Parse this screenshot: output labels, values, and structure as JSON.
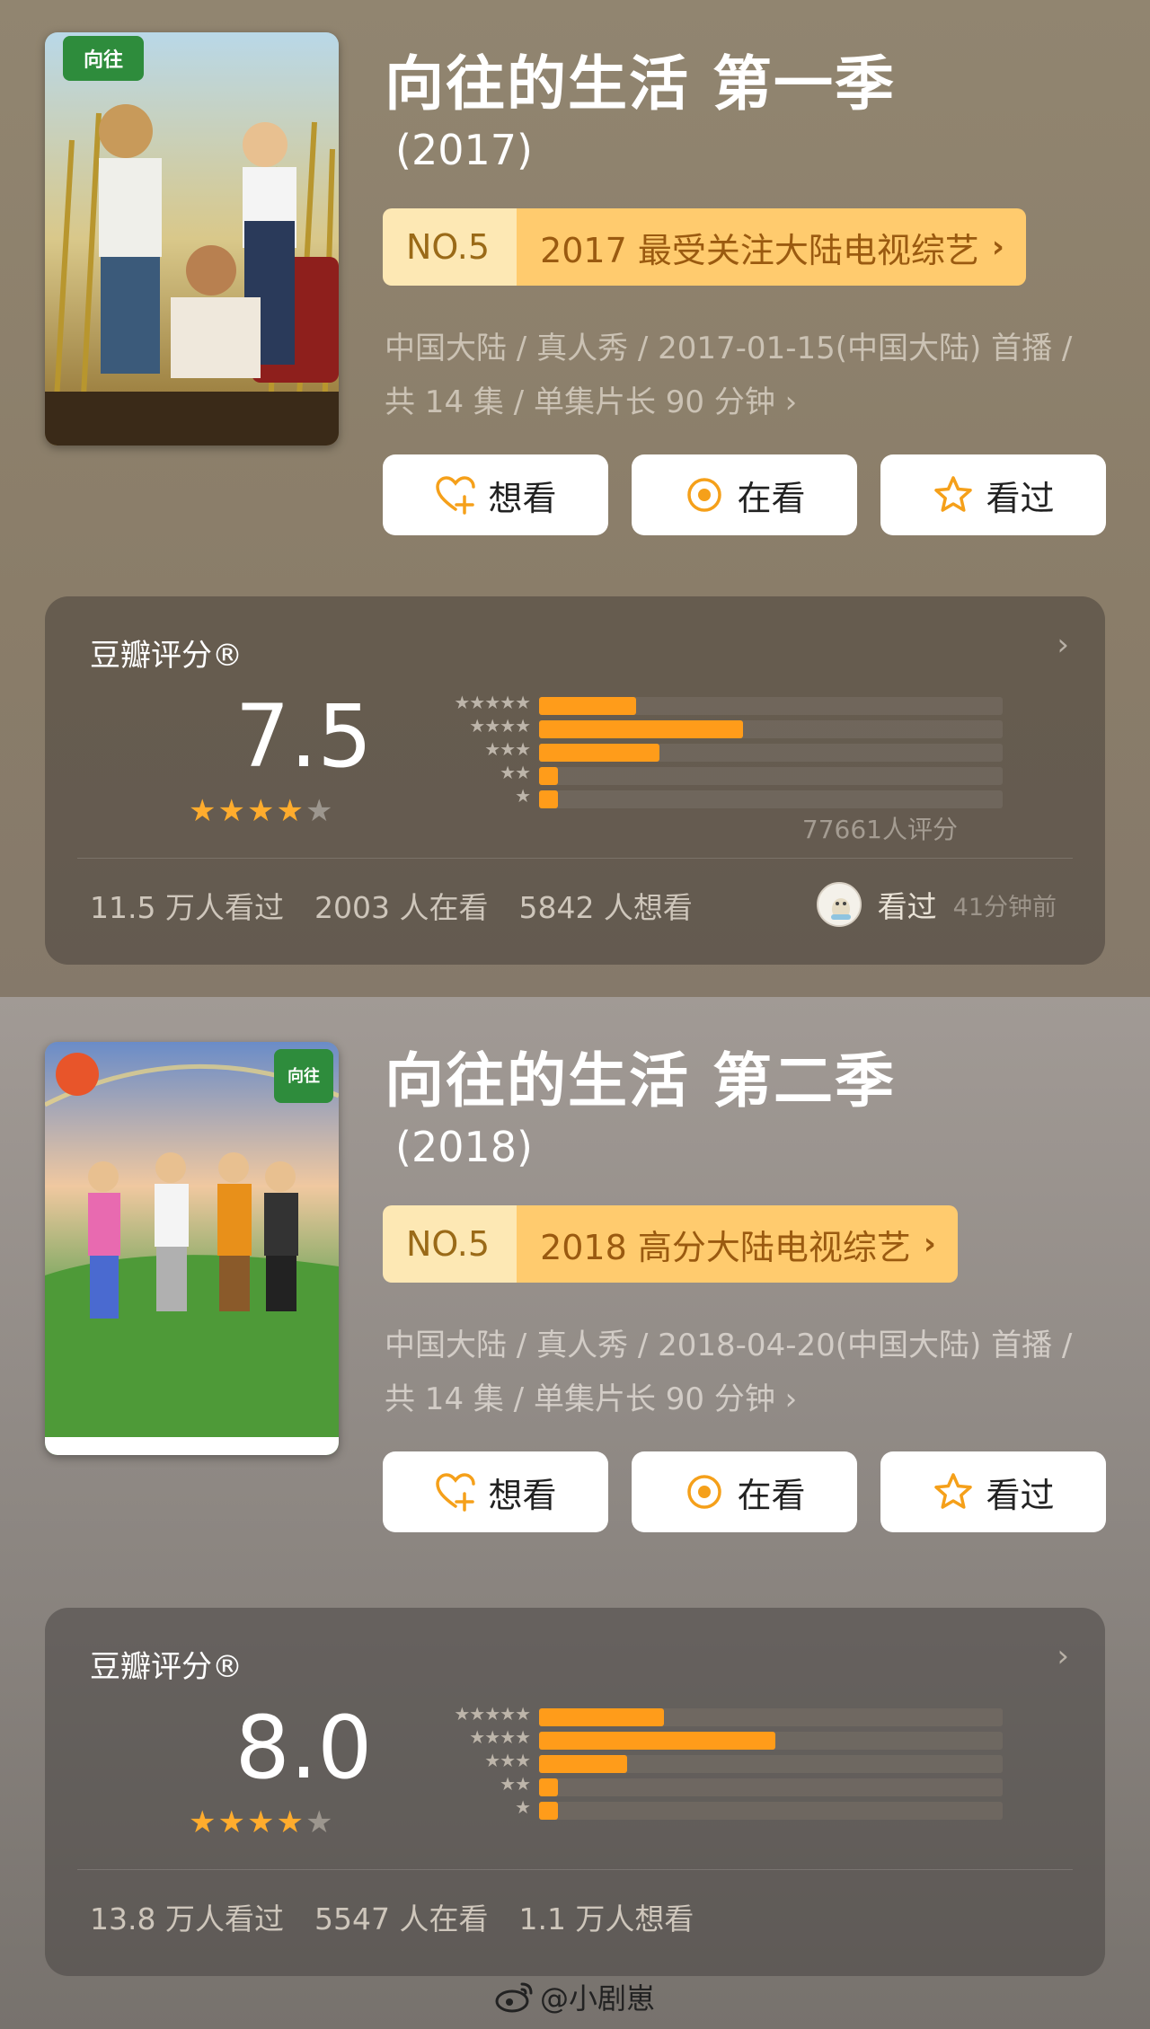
{
  "seasons": [
    {
      "title": "向往的生活 第一季",
      "year": "(2017)",
      "rank_no": "NO.5",
      "rank_label": "2017 最受关注大陆电视综艺",
      "meta_line1": "中国大陆 / 真人秀 / 2017-01-15(中国大陆) 首播 /",
      "meta_line2": "共 14 集 / 单集片长 90 分钟",
      "buttons": {
        "want": "想看",
        "watching": "在看",
        "watched": "看过"
      },
      "rating_title": "豆瓣评分®",
      "score": "7.5",
      "star_rating": 4,
      "distribution": [
        0.21,
        0.44,
        0.26,
        0.04,
        0.04
      ],
      "rating_count": "77661人评分",
      "stats": {
        "watched": "11.5 万人看过",
        "watching": "2003 人在看",
        "want": "5842 人想看"
      },
      "recent": {
        "action": "看过",
        "time": "41分钟前"
      }
    },
    {
      "title": "向往的生活 第二季",
      "year": "(2018)",
      "rank_no": "NO.5",
      "rank_label": "2018 高分大陆电视综艺",
      "meta_line1": "中国大陆 / 真人秀 / 2018-04-20(中国大陆) 首播 /",
      "meta_line2": "共 14 集 / 单集片长 90 分钟",
      "buttons": {
        "want": "想看",
        "watching": "在看",
        "watched": "看过"
      },
      "rating_title": "豆瓣评分®",
      "score": "8.0",
      "star_rating": 4,
      "distribution": [
        0.27,
        0.51,
        0.19,
        0.04,
        0.04
      ],
      "stats": {
        "watched": "13.8 万人看过",
        "watching": "5547 人在看",
        "want": "1.1 万人想看"
      }
    }
  ],
  "footer": {
    "handle": "@小剧崽"
  },
  "icons": [
    "heart-plus-icon",
    "target-icon",
    "star-outline-icon",
    "chevron-right-icon",
    "weibo-icon"
  ],
  "colors": {
    "accent_orange": "#ff9c1a",
    "rank_light": "#fde8b4",
    "rank_dark": "#ffcb6e"
  }
}
